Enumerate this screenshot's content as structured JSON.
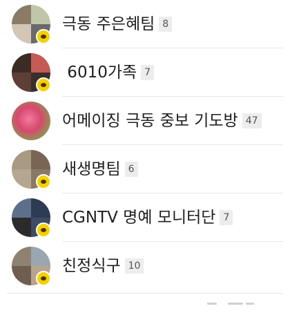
{
  "rooms": [
    {
      "name": "극동 주은혜팀",
      "count": "8"
    },
    {
      "name": " 6010가족",
      "count": "7"
    },
    {
      "name": "어메이징 극동 중보 기도방",
      "count": "47"
    },
    {
      "name": "새생명팀",
      "count": "6"
    },
    {
      "name": "CGNTV 명예 모니터단",
      "count": "7"
    },
    {
      "name": "친정식구",
      "count": "10"
    }
  ],
  "icons": {
    "room_badge": "kakaotalk-chat-bubble-icon",
    "avatar": "group-photo-collage"
  },
  "colors": {
    "badge": "#f5d000",
    "count_bg": "#ededed",
    "divider": "#e6e6e6"
  }
}
